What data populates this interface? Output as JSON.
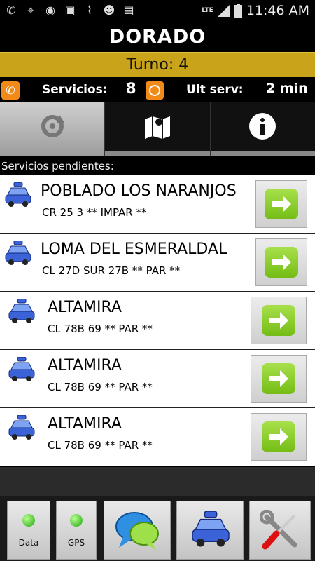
{
  "status_bar": {
    "time": "11:46 AM",
    "network": "LTE",
    "icons": [
      "call-muted-icon",
      "location-icon",
      "taxi-app-icon",
      "image-icon",
      "broom-icon",
      "cat-icon",
      "briefcase-icon",
      "signal-icon",
      "battery-icon"
    ]
  },
  "header": {
    "title": "DORADO",
    "turno": "Turno: 4"
  },
  "info": {
    "servicios_label": "Servicios:",
    "servicios_value": "8",
    "ult_label": "Ult serv:",
    "ult_value": "2 min"
  },
  "tabs": [
    {
      "icon": "refresh-icon",
      "active": true
    },
    {
      "icon": "map-icon",
      "active": false
    },
    {
      "icon": "info-icon",
      "active": false
    }
  ],
  "section_label": "Servicios pendientes:",
  "services": [
    {
      "name": "POBLADO LOS NARANJOS",
      "address": "CR 25 3  ** IMPAR **"
    },
    {
      "name": "LOMA DEL ESMERALDAL",
      "address": "CL 27D SUR 27B  ** PAR **"
    },
    {
      "name": "ALTAMIRA",
      "address": "CL 78B 69  ** PAR **"
    },
    {
      "name": "ALTAMIRA",
      "address": "CL 78B 69  ** PAR **"
    },
    {
      "name": "ALTAMIRA",
      "address": "CL 78B 69  ** PAR **"
    }
  ],
  "bottom": {
    "data_label": "Data",
    "gps_label": "GPS"
  },
  "colors": {
    "turno_bar": "#c9a31a",
    "accent_orange": "#f28a1a",
    "go_green": "#8fd02f",
    "taxi_blue": "#3b62d6"
  }
}
